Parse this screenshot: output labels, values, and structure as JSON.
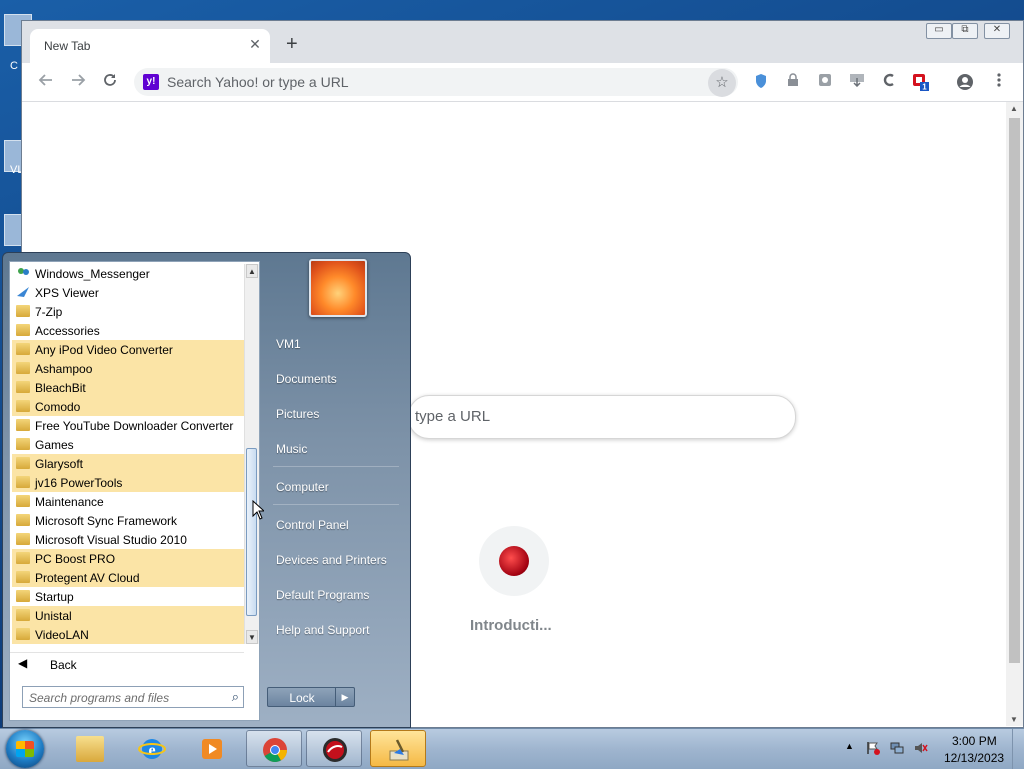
{
  "desktop": {
    "labels": [
      "C",
      "VL"
    ]
  },
  "browser": {
    "tab_title": "New Tab",
    "tab_close": "✕",
    "new_tab": "+",
    "window_controls": [
      "▭",
      "⧉",
      "✕"
    ],
    "omnibox_placeholder": "Search Yahoo! or type a URL",
    "search_engine_icon": "y!",
    "extension_badge": "1",
    "page_search_text": "type a URL",
    "tile_label": "Introducti...",
    "colors": {
      "tabstrip": "#dee1e6",
      "yahoo": "#6001d2",
      "ext_red": "#d4121e"
    },
    "icons": [
      "back-arrow-icon",
      "forward-arrow-icon",
      "reload-icon",
      "bookmark-star-icon",
      "profile-icon",
      "menu-icon"
    ]
  },
  "start_menu": {
    "programs": [
      {
        "label": "Windows_Messenger",
        "icon": "messenger-icon",
        "highlight": false
      },
      {
        "label": "XPS Viewer",
        "icon": "xps-viewer-icon",
        "highlight": false
      },
      {
        "label": "7-Zip",
        "icon": "folder-icon",
        "highlight": false
      },
      {
        "label": "Accessories",
        "icon": "folder-icon",
        "highlight": false
      },
      {
        "label": "Any iPod Video Converter",
        "icon": "folder-icon",
        "highlight": true
      },
      {
        "label": "Ashampoo",
        "icon": "folder-icon",
        "highlight": true
      },
      {
        "label": "BleachBit",
        "icon": "folder-icon",
        "highlight": true
      },
      {
        "label": "Comodo",
        "icon": "folder-icon",
        "highlight": true
      },
      {
        "label": "Free YouTube Downloader Converter",
        "icon": "folder-icon",
        "highlight": false
      },
      {
        "label": "Games",
        "icon": "folder-icon",
        "highlight": false
      },
      {
        "label": "Glarysoft",
        "icon": "folder-icon",
        "highlight": true
      },
      {
        "label": "jv16 PowerTools",
        "icon": "folder-icon",
        "highlight": true
      },
      {
        "label": "Maintenance",
        "icon": "folder-icon",
        "highlight": false
      },
      {
        "label": "Microsoft Sync Framework",
        "icon": "folder-icon",
        "highlight": false
      },
      {
        "label": "Microsoft Visual Studio 2010",
        "icon": "folder-icon",
        "highlight": false
      },
      {
        "label": "PC Boost PRO",
        "icon": "folder-icon",
        "highlight": true
      },
      {
        "label": "Protegent AV Cloud",
        "icon": "folder-icon",
        "highlight": true
      },
      {
        "label": "Startup",
        "icon": "folder-icon",
        "highlight": false
      },
      {
        "label": "Unistal",
        "icon": "folder-icon",
        "highlight": true
      },
      {
        "label": "VideoLAN",
        "icon": "folder-icon",
        "highlight": true
      }
    ],
    "back_label": "Back",
    "search_placeholder": "Search programs and files",
    "right_items": [
      "VM1",
      "Documents",
      "Pictures",
      "Music",
      "Computer",
      "Control Panel",
      "Devices and Printers",
      "Default Programs",
      "Help and Support"
    ],
    "lock_label": "Lock",
    "lock_arrow": "▶",
    "highlight_color": "#fbe4a6"
  },
  "taskbar": {
    "items": [
      "start-orb",
      "explorer",
      "internet-explorer",
      "media-player",
      "chrome",
      "protegent",
      "cleaner"
    ],
    "tray_arrow": "▲",
    "time": "3:00 PM",
    "date": "12/13/2023"
  }
}
